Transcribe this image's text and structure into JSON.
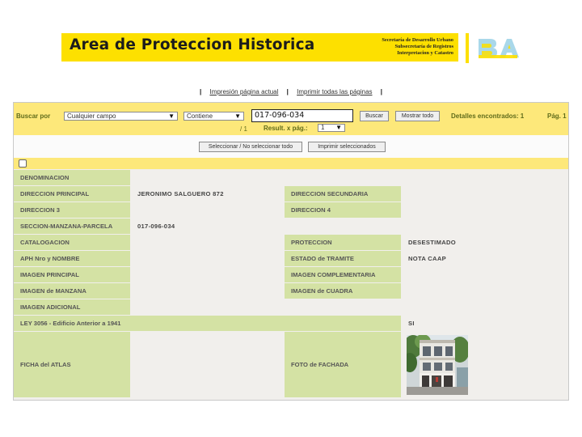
{
  "banner": {
    "title": "Area de Proteccion Historica",
    "sub_line1": "Secretaría de Desarrollo Urbano",
    "sub_line2": "Subsecretaría de Registros",
    "sub_line3": "Interpretacion y Catastro",
    "logo_text": "BA"
  },
  "print_links": {
    "current_page": "Impresión página actual",
    "all_pages": "Imprimir todas las páginas",
    "separator": "|"
  },
  "search": {
    "search_by_label": "Buscar por",
    "field_select": "Cualquier campo",
    "operator_select": "Contiene",
    "query_value": "017-096-034",
    "search_button": "Buscar",
    "show_all_button": "Mostrar todo",
    "details_found": "Detalles encontrados: 1",
    "page_label": "Pág. 1",
    "page_total": "/ 1",
    "results_per_page_label": "Result. x pág.:",
    "results_per_page_value": "1"
  },
  "selection": {
    "toggle_select_button": "Seleccionar / No seleccionar todo",
    "print_selected_button": "Imprimir seleccionados"
  },
  "record": {
    "denominacion": {
      "label": "DENOMINACION",
      "value": ""
    },
    "direccion_principal": {
      "label": "DIRECCION PRINCIPAL",
      "value": "JERONIMO SALGUERO 872"
    },
    "direccion_secundaria": {
      "label": "DIRECCION SECUNDARIA",
      "value": ""
    },
    "direccion_3": {
      "label": "DIRECCION 3",
      "value": ""
    },
    "direccion_4": {
      "label": "DIRECCION 4",
      "value": ""
    },
    "smp": {
      "label": "SECCION-MANZANA-PARCELA",
      "value": "017-096-034"
    },
    "catalogacion": {
      "label": "CATALOGACION",
      "value": ""
    },
    "proteccion": {
      "label": "PROTECCION",
      "value": "DESESTIMADO"
    },
    "aph": {
      "label": "APH Nro y NOMBRE",
      "value": ""
    },
    "estado_tramite": {
      "label": "ESTADO de TRAMITE",
      "value": "NOTA CAAP"
    },
    "imagen_principal": {
      "label": "IMAGEN PRINCIPAL",
      "value": ""
    },
    "imagen_complementaria": {
      "label": "IMAGEN COMPLEMENTARIA",
      "value": ""
    },
    "imagen_manzana": {
      "label": "IMAGEN de MANZANA",
      "value": ""
    },
    "imagen_cuadra": {
      "label": "IMAGEN de CUADRA",
      "value": ""
    },
    "imagen_adicional": {
      "label": "IMAGEN ADICIONAL",
      "value": ""
    },
    "ley_3056": {
      "label": "LEY 3056 - Edificio Anterior a 1941",
      "value": "SI"
    },
    "ficha_atlas": {
      "label": "FICHA del ATLAS",
      "value": ""
    },
    "foto_fachada": {
      "label": "FOTO de FACHADA"
    }
  },
  "colors": {
    "brand_yellow": "#fde000",
    "strip_yellow": "#fde87a",
    "label_green": "#d4e2a4",
    "label_text": "#5f6b1a",
    "value_bg": "#f1efec"
  }
}
